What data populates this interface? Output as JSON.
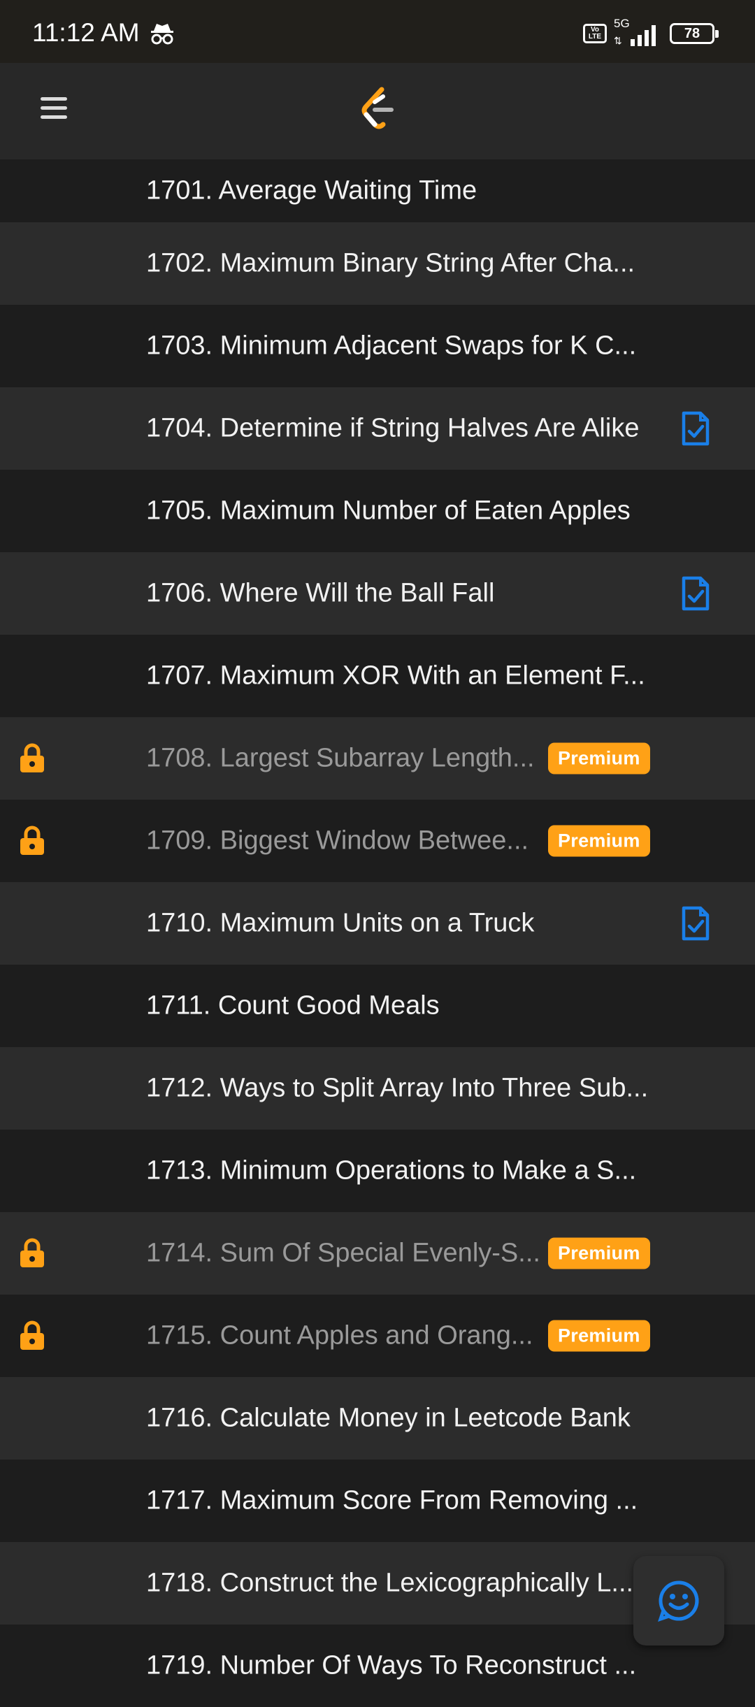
{
  "status_bar": {
    "time": "11:12 AM",
    "network": "5G",
    "volte": "Vo LTE",
    "battery": "78",
    "icons": [
      "incognito-icon",
      "volte-icon",
      "signal-icon",
      "battery-icon"
    ]
  },
  "header": {
    "menu_icon": "hamburger-menu-icon",
    "logo_icon": "leetcode-logo-icon"
  },
  "colors": {
    "premium": "#ffa116",
    "solution": "#1a7fe8",
    "row_dark": "#1d1d1d",
    "row_light": "#2c2c2c"
  },
  "problems": [
    {
      "title": "1701. Average Waiting Time",
      "locked": false,
      "premium": "",
      "solution": false
    },
    {
      "title": "1702. Maximum Binary String After Cha...",
      "locked": false,
      "premium": "",
      "solution": false
    },
    {
      "title": "1703. Minimum Adjacent Swaps for K C...",
      "locked": false,
      "premium": "",
      "solution": false
    },
    {
      "title": "1704. Determine if String Halves Are Alike",
      "locked": false,
      "premium": "",
      "solution": true
    },
    {
      "title": "1705. Maximum Number of Eaten Apples",
      "locked": false,
      "premium": "",
      "solution": false
    },
    {
      "title": "1706. Where Will the Ball Fall",
      "locked": false,
      "premium": "",
      "solution": true
    },
    {
      "title": "1707. Maximum XOR With an Element F...",
      "locked": false,
      "premium": "",
      "solution": false
    },
    {
      "title": "1708. Largest Subarray Length...",
      "locked": true,
      "premium": "Premium",
      "solution": false
    },
    {
      "title": "1709. Biggest Window Betwee...",
      "locked": true,
      "premium": "Premium",
      "solution": false
    },
    {
      "title": "1710. Maximum Units on a Truck",
      "locked": false,
      "premium": "",
      "solution": true
    },
    {
      "title": "1711. Count Good Meals",
      "locked": false,
      "premium": "",
      "solution": false
    },
    {
      "title": "1712. Ways to Split Array Into Three Sub...",
      "locked": false,
      "premium": "",
      "solution": false
    },
    {
      "title": "1713. Minimum Operations to Make a S...",
      "locked": false,
      "premium": "",
      "solution": false
    },
    {
      "title": "1714. Sum Of Special Evenly-S...",
      "locked": true,
      "premium": "Premium",
      "solution": false
    },
    {
      "title": "1715. Count Apples and Orang...",
      "locked": true,
      "premium": "Premium",
      "solution": false
    },
    {
      "title": "1716. Calculate Money in Leetcode Bank",
      "locked": false,
      "premium": "",
      "solution": false
    },
    {
      "title": "1717. Maximum Score From Removing ...",
      "locked": false,
      "premium": "",
      "solution": false
    },
    {
      "title": "1718. Construct the Lexicographically L...",
      "locked": false,
      "premium": "",
      "solution": false
    },
    {
      "title": "1719. Number Of Ways To Reconstruct ...",
      "locked": false,
      "premium": "",
      "solution": false
    }
  ],
  "feedback": {
    "icon": "smiley-feedback-icon"
  }
}
